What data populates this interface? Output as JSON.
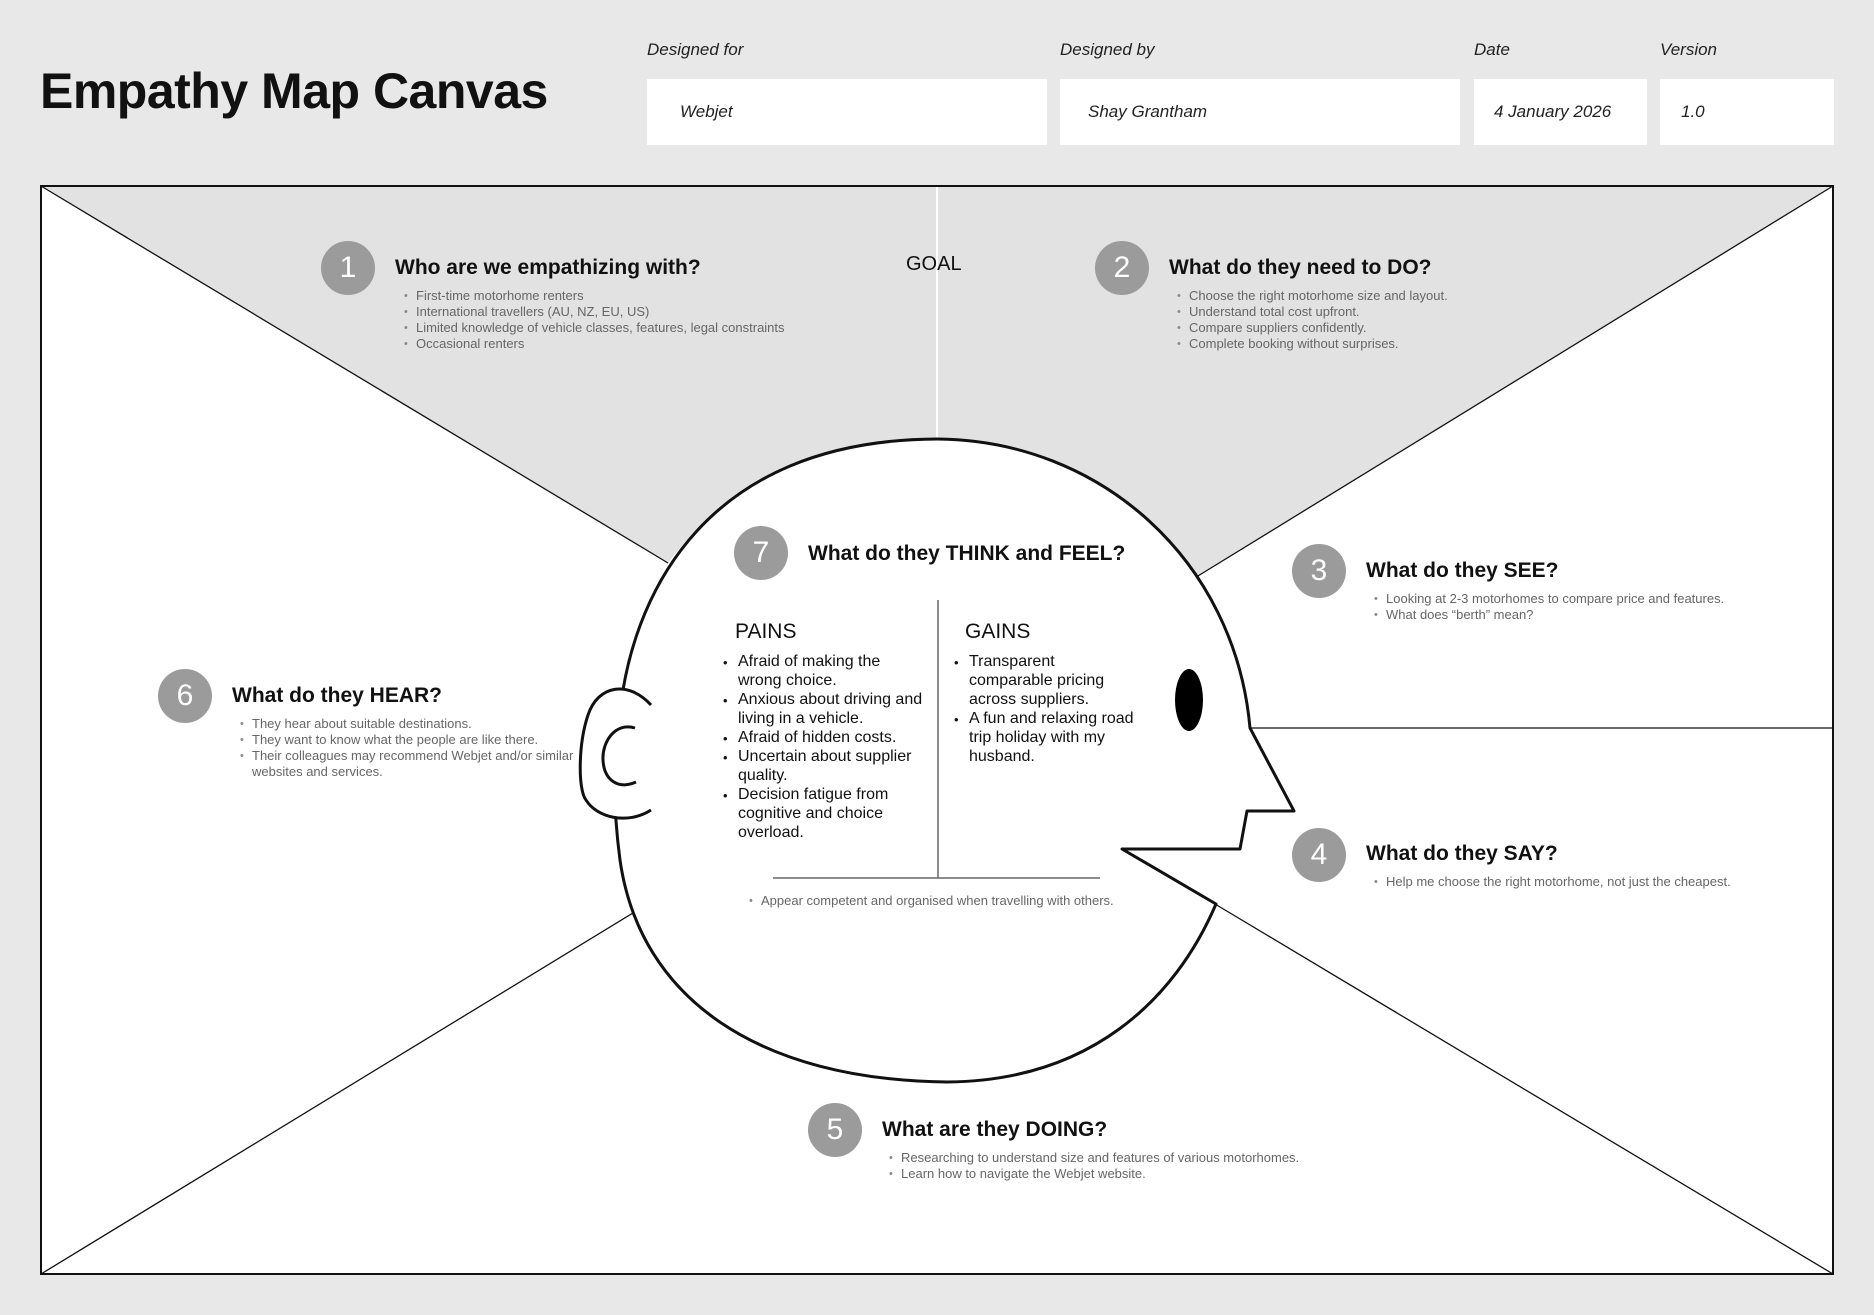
{
  "title": "Empathy Map Canvas",
  "meta": {
    "designed_for_label": "Designed for",
    "designed_for_value": "Webjet",
    "designed_by_label": "Designed by",
    "designed_by_value": "Shay Grantham",
    "date_label": "Date",
    "date_value": "4 January 2026",
    "version_label": "Version",
    "version_value": "1.0"
  },
  "goal_label": "GOAL",
  "sections": {
    "who": {
      "number": "1",
      "heading": "Who are we empathizing with?",
      "items": [
        "First-time motorhome renters",
        "International travellers (AU, NZ, EU, US)",
        "Limited knowledge of vehicle classes, features, legal constraints",
        "Occasional renters"
      ]
    },
    "do": {
      "number": "2",
      "heading": "What do they need to DO?",
      "items": [
        "Choose the right motorhome size and layout.",
        "Understand total cost upfront.",
        "Compare suppliers confidently.",
        "Complete booking without surprises."
      ]
    },
    "see": {
      "number": "3",
      "heading": "What do they SEE?",
      "items": [
        "Looking at 2-3 motorhomes to compare price and features.",
        "What does “berth” mean?"
      ]
    },
    "say": {
      "number": "4",
      "heading": "What do they SAY?",
      "items": [
        "Help me choose the right motorhome, not just the cheapest."
      ]
    },
    "doing": {
      "number": "5",
      "heading": "What are they DOING?",
      "items": [
        "Researching to understand size and features of various motorhomes.",
        "Learn how to navigate the Webjet website."
      ]
    },
    "hear": {
      "number": "6",
      "heading": "What do they HEAR?",
      "items": [
        "They hear about suitable destinations.",
        "They want to know what the people are like there.",
        "Their colleagues may recommend Webjet and/or similar websites and services."
      ]
    },
    "think": {
      "number": "7",
      "heading": "What do they THINK and FEEL?",
      "pains_label": "PAINS",
      "pains": [
        "Afraid of making the wrong choice.",
        "Anxious about driving and living in a vehicle.",
        "Afraid of hidden costs.",
        "Uncertain about supplier quality.",
        "Decision fatigue from cognitive and choice overload."
      ],
      "gains_label": "GAINS",
      "gains": [
        "Transparent comparable pricing across suppliers.",
        "A fun and relaxing road trip holiday with my husband."
      ],
      "footer": [
        "Appear competent and organised when travelling with others."
      ]
    }
  },
  "colors": {
    "background": "#e8e8e8",
    "panel": "#ffffff",
    "goal_area": "#e2e2e2",
    "badge": "#9b9b9b",
    "line": "#111111"
  }
}
